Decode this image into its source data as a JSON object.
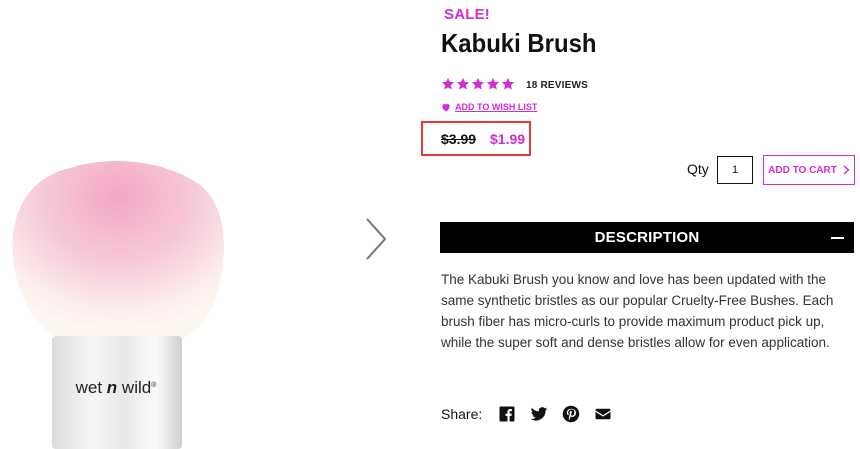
{
  "product": {
    "sale_label": "SALE!",
    "title": "Kabuki Brush",
    "rating": 5,
    "reviews_text": "18 REVIEWS",
    "wishlist_label": "ADD TO WISH LIST",
    "old_price": "$3.99",
    "sale_price": "$1.99",
    "brand_logo_text": "wet n wild"
  },
  "purchase": {
    "qty_label": "Qty",
    "qty_value": "1",
    "add_to_cart_label": "ADD TO CART"
  },
  "description": {
    "title": "DESCRIPTION",
    "text": "The Kabuki Brush you know and love has been updated with the same synthetic bristles as our popular Cruelty-Free Bushes. Each brush fiber has micro-curls to provide maximum product pick up, while the super soft and dense bristles allow for even application."
  },
  "share": {
    "label": "Share:",
    "icons": [
      "facebook-icon",
      "twitter-icon",
      "pinterest-icon",
      "email-icon"
    ]
  },
  "colors": {
    "accent": "#d42bd2",
    "highlight_border": "#e53935",
    "bar": "#000000"
  }
}
